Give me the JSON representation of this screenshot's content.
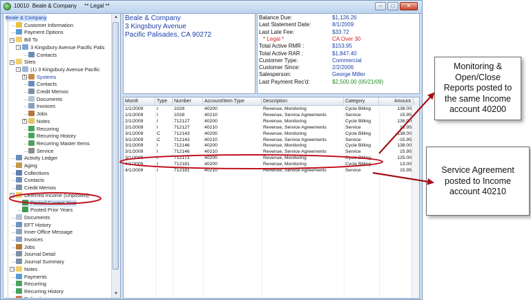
{
  "window": {
    "title": "10010  Beale & Company     ** Legal **",
    "min": "–",
    "max": "□",
    "close": "✕"
  },
  "tree": {
    "items": [
      {
        "label": "Beale & Company",
        "style": "blue sel",
        "icon": "",
        "indent": 0
      },
      {
        "label": "Customer Information",
        "style": "",
        "icon": "customer-info-icon",
        "indent": 1
      },
      {
        "label": "Payment Options",
        "style": "",
        "icon": "payment-options-icon",
        "indent": 1
      },
      {
        "label": "Bill To",
        "style": "",
        "icon": "folder-icon",
        "indent": 1
      },
      {
        "label": "3 Kingsbury Avenue Pacific Palis",
        "style": "",
        "icon": "address-icon",
        "indent": 2
      },
      {
        "label": "Contacts",
        "style": "",
        "icon": "contacts-icon",
        "indent": 3
      },
      {
        "label": "Sites",
        "style": "",
        "icon": "folder-icon",
        "indent": 1
      },
      {
        "label": "(1) 3 Kingsbury Avenue Pacific",
        "style": "",
        "icon": "site-icon",
        "indent": 2
      },
      {
        "label": "Systems",
        "style": "link",
        "icon": "systems-icon",
        "indent": 3
      },
      {
        "label": "Contacts",
        "style": "",
        "icon": "contacts-icon",
        "indent": 3
      },
      {
        "label": "Credit Memos",
        "style": "",
        "icon": "credit-memo-icon",
        "indent": 3
      },
      {
        "label": "Documents",
        "style": "",
        "icon": "documents-icon",
        "indent": 3
      },
      {
        "label": "Invoices",
        "style": "",
        "icon": "invoices-icon",
        "indent": 3
      },
      {
        "label": "Jobs",
        "style": "",
        "icon": "jobs-icon",
        "indent": 3
      },
      {
        "label": "Notes",
        "style": "",
        "icon": "notes-icon",
        "indent": 3
      },
      {
        "label": "Recurring",
        "style": "",
        "icon": "recurring-icon",
        "indent": 3
      },
      {
        "label": "Recurring History",
        "style": "",
        "icon": "recurring-history-icon",
        "indent": 3
      },
      {
        "label": "Recurring Master Items",
        "style": "",
        "icon": "recurring-master-icon",
        "indent": 3
      },
      {
        "label": "Service",
        "style": "",
        "icon": "service-icon",
        "indent": 3
      },
      {
        "label": "Activity Ledger",
        "style": "",
        "icon": "ledger-icon",
        "indent": 1
      },
      {
        "label": "Aging",
        "style": "",
        "icon": "aging-icon",
        "indent": 1
      },
      {
        "label": "Collections",
        "style": "",
        "icon": "collections-icon",
        "indent": 1
      },
      {
        "label": "Contacts",
        "style": "",
        "icon": "contacts-icon",
        "indent": 1
      },
      {
        "label": "Credit Memos",
        "style": "",
        "icon": "credit-memo-icon",
        "indent": 1
      },
      {
        "label": "Deferred Income (Unposted)",
        "style": "",
        "icon": "folder-icon",
        "indent": 1
      },
      {
        "label": "Posted Current Year",
        "style": "sel",
        "icon": "posted-icon",
        "indent": 2
      },
      {
        "label": "Posted Prior Years",
        "style": "",
        "icon": "posted-icon",
        "indent": 2
      },
      {
        "label": "Documents",
        "style": "",
        "icon": "documents-icon",
        "indent": 1
      },
      {
        "label": "EFT History",
        "style": "",
        "icon": "eft-icon",
        "indent": 1
      },
      {
        "label": "Inner Office Message",
        "style": "",
        "icon": "message-icon",
        "indent": 1
      },
      {
        "label": "Invoices",
        "style": "",
        "icon": "invoices-icon",
        "indent": 1
      },
      {
        "label": "Jobs",
        "style": "",
        "icon": "jobs-icon",
        "indent": 1
      },
      {
        "label": "Journal Detail",
        "style": "",
        "icon": "journal-icon",
        "indent": 1
      },
      {
        "label": "Journal Summary",
        "style": "",
        "icon": "journal-icon",
        "indent": 1
      },
      {
        "label": "Notes",
        "style": "",
        "icon": "folder-icon",
        "indent": 1
      },
      {
        "label": "Payments",
        "style": "",
        "icon": "payments-icon",
        "indent": 1
      },
      {
        "label": "Recurring",
        "style": "",
        "icon": "recurring-icon",
        "indent": 1
      },
      {
        "label": "Recurring History",
        "style": "",
        "icon": "recurring-history-icon",
        "indent": 1
      },
      {
        "label": "Refunds",
        "style": "",
        "icon": "refunds-icon",
        "indent": 1
      }
    ]
  },
  "address": {
    "name": "Beale & Company",
    "street": "3 Kingsbury Avenue",
    "city": "Pacific Palisades, CA  90272"
  },
  "balance": {
    "rows": [
      {
        "label": "Balance Due:",
        "value": "$1,126.26",
        "style": ""
      },
      {
        "label": "Last Statement Date:",
        "value": "8/1/2009",
        "style": ""
      },
      {
        "label": "Last Late Fee:",
        "value": "$33.72",
        "style": ""
      },
      {
        "label": "* Legal *",
        "value": "CA Over 30",
        "style": "red"
      },
      {
        "label": "Total Active RMR :",
        "value": "$153.95",
        "style": ""
      },
      {
        "label": "Total Active RAR :",
        "value": "$1,847.40",
        "style": ""
      },
      {
        "label": "Customer Type:",
        "value": "Commercial",
        "style": ""
      },
      {
        "label": "Customer Since:",
        "value": "2/2/2006",
        "style": ""
      },
      {
        "label": "Salesperson:",
        "value": "George Miller",
        "style": ""
      },
      {
        "label": "Last Payment Rec'd:",
        "value": "$2,500.00 (05/21/09)",
        "style": "green"
      }
    ]
  },
  "grid": {
    "columns": [
      "Month",
      "Type",
      "Number",
      "Account/Item Type",
      "Description",
      "Category",
      "Amount"
    ],
    "rows": [
      [
        "1/1/2009",
        "I",
        "1028",
        "40200",
        "Revenue, Monitoring",
        "Cycle Billing",
        "138.00"
      ],
      [
        "1/1/2009",
        "I",
        "1028",
        "40210",
        "Revenue, Service Agreements",
        "Service",
        "15.95"
      ],
      [
        "2/1/2009",
        "I",
        "712127",
        "40200",
        "Revenue, Monitoring",
        "Cycle Billing",
        "138.00"
      ],
      [
        "2/1/2009",
        "I",
        "712127",
        "40210",
        "Revenue, Service Agreements",
        "Service",
        "15.95"
      ],
      [
        "3/1/2009",
        "C",
        "712143",
        "40200",
        "Revenue, Monitoring",
        "Cycle Billing",
        "-138.00"
      ],
      [
        "3/1/2009",
        "C",
        "712143",
        "40210",
        "Revenue, Service Agreements",
        "Service",
        "-15.95"
      ],
      [
        "3/1/2009",
        "I",
        "712146",
        "40200",
        "Revenue, Monitoring",
        "Cycle Billing",
        "138.00"
      ],
      [
        "3/1/2009",
        "I",
        "712146",
        "40210",
        "Revenue, Service Agreements",
        "Service",
        "15.95"
      ],
      [
        "3/1/2009",
        "I",
        "712171",
        "40200",
        "Revenue, Monitoring",
        "Cycle Billing",
        "125.00"
      ],
      [
        "4/1/2009",
        "I",
        "712181",
        "40200",
        "Revenue, Monitoring",
        "Cycle Billing",
        "13.00"
      ],
      [
        "4/1/2009",
        "I",
        "712181",
        "40210",
        "Revenue, Service Agreements",
        "Service",
        "15.95"
      ]
    ]
  },
  "annotations": {
    "callout1": [
      "Monitoring &",
      "Open/Close",
      "Reports posted to",
      "the same Income",
      "account 40200"
    ],
    "callout2": [
      "Service Agreement",
      "posted to Income",
      "account 40210"
    ],
    "highlight_color": "#c0131e",
    "arrow_color": "#a50f18"
  }
}
